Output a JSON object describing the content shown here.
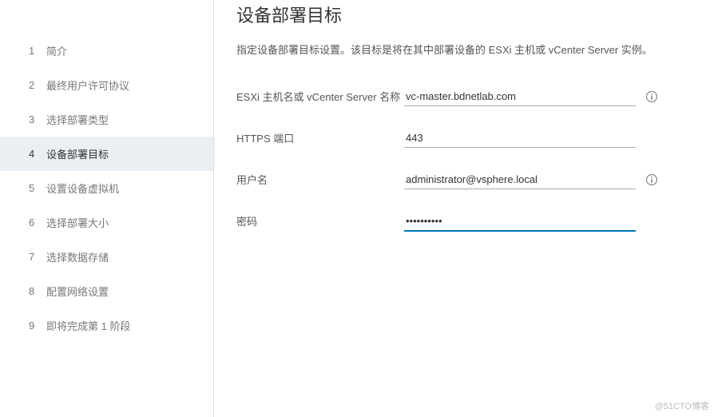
{
  "sidebar": {
    "steps": [
      {
        "num": "1",
        "label": "简介"
      },
      {
        "num": "2",
        "label": "最终用户许可协议"
      },
      {
        "num": "3",
        "label": "选择部署类型"
      },
      {
        "num": "4",
        "label": "设备部署目标"
      },
      {
        "num": "5",
        "label": "设置设备虚拟机"
      },
      {
        "num": "6",
        "label": "选择部署大小"
      },
      {
        "num": "7",
        "label": "选择数据存储"
      },
      {
        "num": "8",
        "label": "配置网络设置"
      },
      {
        "num": "9",
        "label": "即将完成第 1 阶段"
      }
    ],
    "active_index": 3
  },
  "main": {
    "title": "设备部署目标",
    "desc": "指定设备部署目标设置。该目标是将在其中部署设备的 ESXi 主机或 vCenter Server 实例。",
    "fields": {
      "host": {
        "label": "ESXi 主机名或 vCenter Server 名称",
        "value": "vc-master.bdnetlab.com",
        "has_info": true
      },
      "port": {
        "label": "HTTPS 端口",
        "value": "443",
        "has_info": false
      },
      "user": {
        "label": "用户名",
        "value": "administrator@vsphere.local",
        "has_info": true
      },
      "password": {
        "label": "密码",
        "value": "••••••••••",
        "has_info": false,
        "focused": true
      }
    }
  },
  "watermark": "@51CTO博客"
}
